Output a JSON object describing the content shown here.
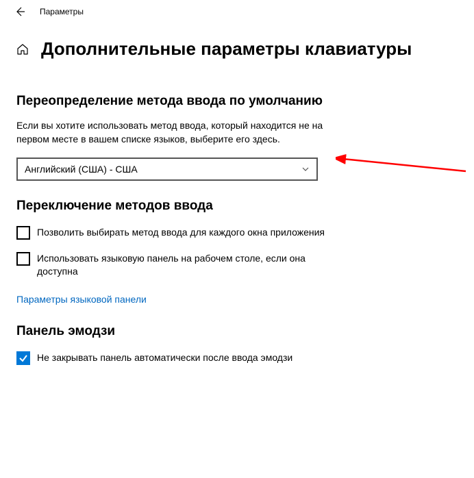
{
  "topbar": {
    "title": "Параметры"
  },
  "page": {
    "title": "Дополнительные параметры клавиатуры"
  },
  "sections": {
    "override": {
      "title": "Переопределение метода ввода по умолчанию",
      "desc": "Если вы хотите использовать метод ввода, который находится не на первом месте в вашем списке языков, выберите его здесь.",
      "selected": "Английский (США) - США"
    },
    "switching": {
      "title": "Переключение методов ввода",
      "cb1": "Позволить выбирать метод ввода для каждого окна приложения",
      "cb2": "Использовать языковую панель на рабочем столе, если она доступна",
      "link": "Параметры языковой панели"
    },
    "emoji": {
      "title": "Панель эмодзи",
      "cb": "Не закрывать панель автоматически после ввода эмодзи"
    }
  }
}
